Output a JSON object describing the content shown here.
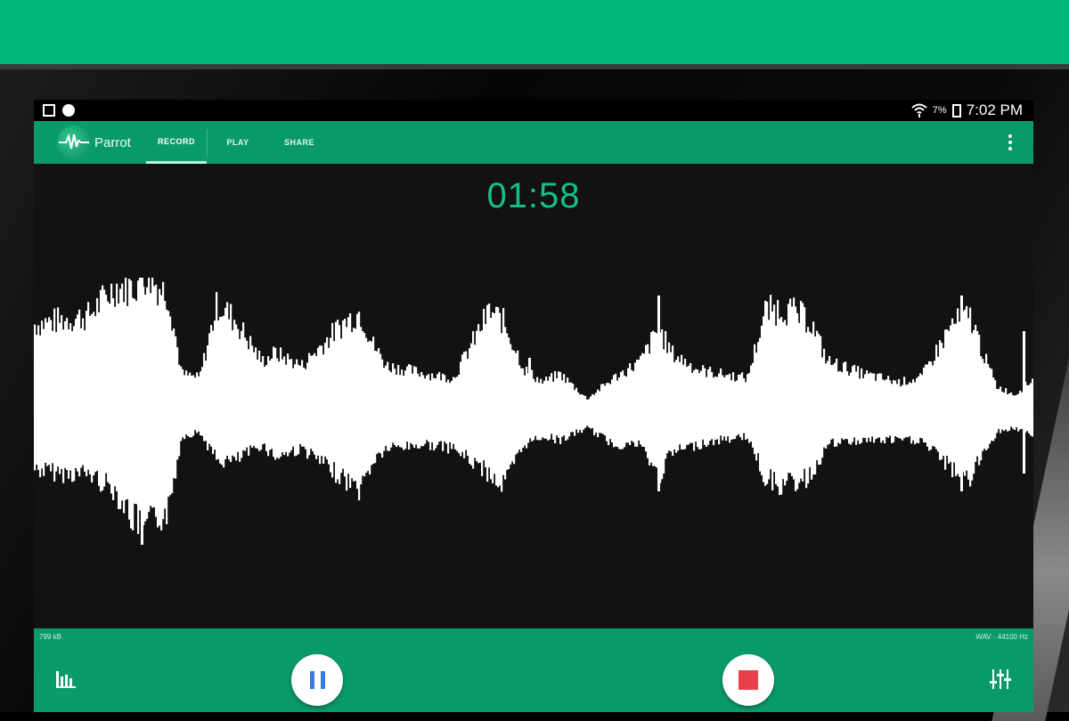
{
  "status_bar": {
    "battery_percent": "7%",
    "time": "7:02 PM"
  },
  "app_bar": {
    "app_name": "Parrot",
    "tabs": [
      {
        "label": "RECORD",
        "active": true
      },
      {
        "label": "PLAY",
        "active": false
      },
      {
        "label": "SHARE",
        "active": false
      }
    ]
  },
  "recorder": {
    "elapsed_time": "01:58",
    "file_size": "799 kB",
    "format": "WAV · 44100 Hz"
  },
  "colors": {
    "brand_green": "#0a9a69",
    "timer_green": "#14c083",
    "pause_blue": "#3a7be0",
    "stop_red": "#e8404a"
  },
  "icons": [
    "image-icon",
    "circle-icon",
    "wifi-icon",
    "battery-icon",
    "waveform-logo-icon",
    "overflow-menu-icon",
    "levels-icon",
    "pause-icon",
    "stop-icon",
    "equalizer-icon"
  ]
}
